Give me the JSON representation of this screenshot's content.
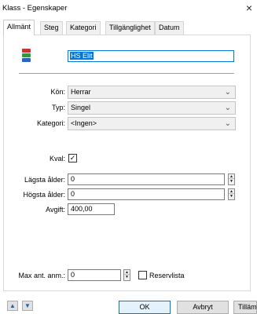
{
  "window": {
    "title": "Klass - Egenskaper",
    "close_glyph": "×"
  },
  "tabs": [
    {
      "label": "Allmänt",
      "active": true
    },
    {
      "label": "Steg",
      "active": false
    },
    {
      "label": "Kategori",
      "active": false
    },
    {
      "label": "Tillgänglighet",
      "active": false
    },
    {
      "label": "Datum",
      "active": false
    }
  ],
  "general": {
    "flag_icon": "flag-icon",
    "flag_colors": [
      "#d03030",
      "#2f9a3a",
      "#2a63c9"
    ],
    "name_value": "HS Elit",
    "gender": {
      "label": "Kön:",
      "value": "Herrar"
    },
    "type": {
      "label": "Typ:",
      "value": "Singel"
    },
    "category": {
      "label": "Kategori:",
      "value": "<Ingen>"
    },
    "qualifier": {
      "label": "Kval:",
      "checked": true,
      "mark": "✓"
    },
    "min_age": {
      "label": "Lägsta ålder:",
      "value": "0"
    },
    "max_age": {
      "label": "Högsta ålder:",
      "value": "0"
    },
    "fee": {
      "label": "Avgift:",
      "value": "400,00"
    },
    "max_entries": {
      "label": "Max ant. anm.:",
      "value": "0"
    },
    "reserve_list": {
      "label": "Reservlista",
      "checked": false
    }
  },
  "buttons": {
    "up_glyph": "▲",
    "down_glyph": "▼",
    "ok": "OK",
    "cancel": "Avbryt",
    "apply": "Tillämpa"
  },
  "colors": {
    "accent": "#0078d7"
  }
}
